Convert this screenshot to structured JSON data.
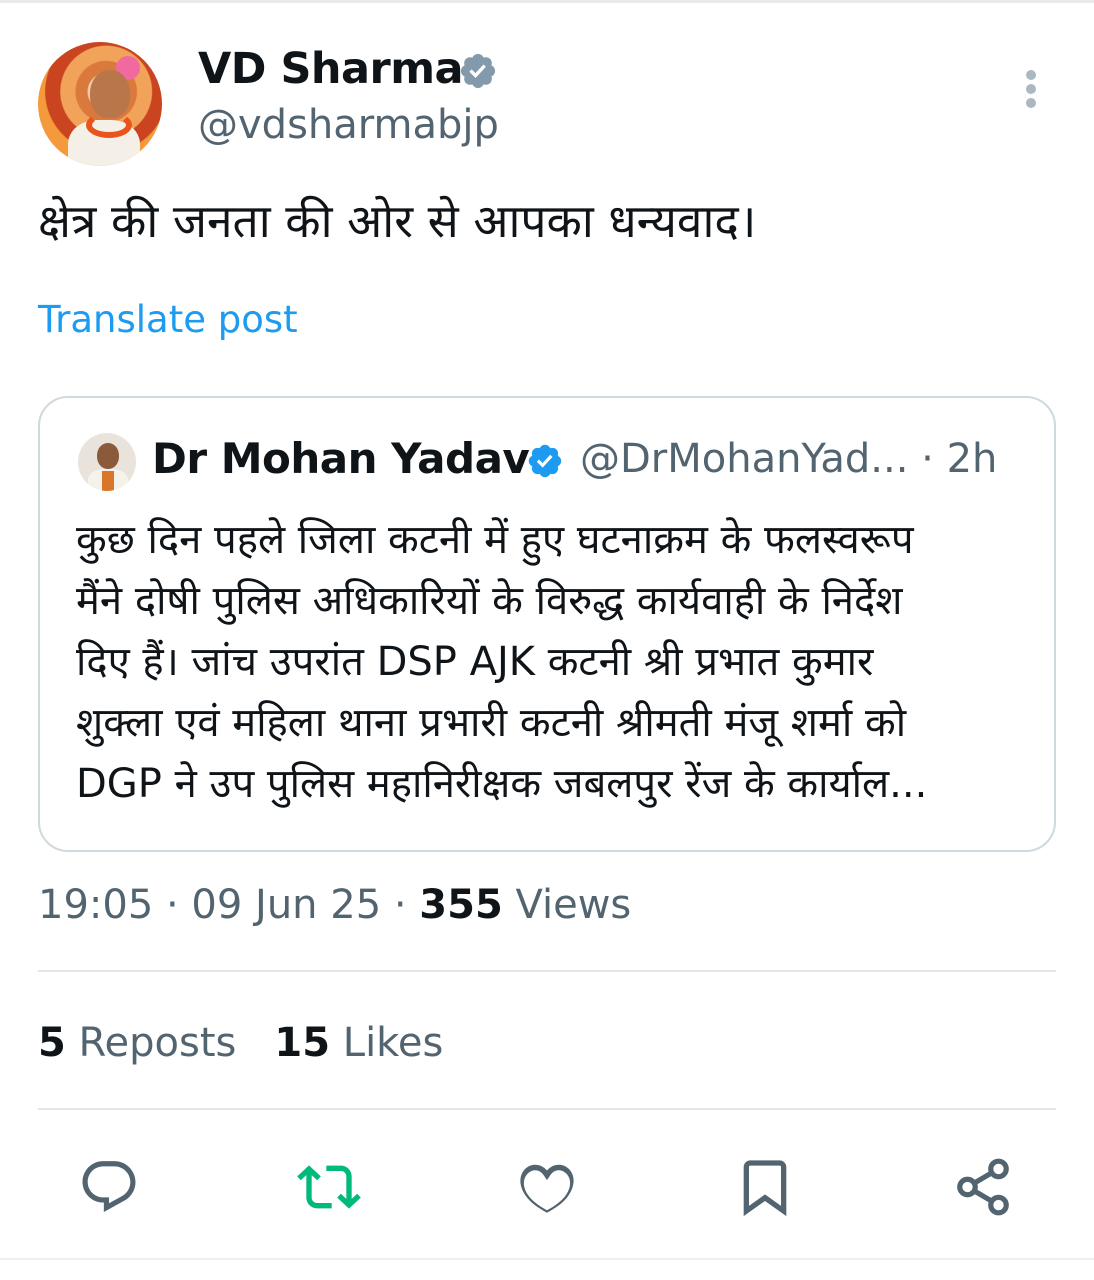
{
  "author": {
    "name": "VD Sharma",
    "handle": "@vdsharmabjp",
    "verified": true
  },
  "tweet": {
    "text": "क्षेत्र की जनता की ओर से आपका धन्यवाद।",
    "translate_label": "Translate post"
  },
  "quote": {
    "name": "Dr Mohan Yadav",
    "handle": "@DrMohanYad... · 2h",
    "verified": true,
    "text_lines": [
      "कुछ दिन पहले जिला कटनी में हुए घटनाक्रम के फलस्वरूप",
      "मैंने दोषी पुलिस अधिकारियों के विरुद्ध कार्यवाही के निर्देश",
      "दिए हैं। जांच उपरांत DSP AJK कटनी श्री प्रभात कुमार",
      "शुक्ला एवं महिला थाना प्रभारी कटनी श्रीमती मंजू शर्मा को",
      "DGP ने उप पुलिस महानिरीक्षक जबलपुर रेंज के कार्याल..."
    ]
  },
  "meta": {
    "time_date": "19:05 · 09 Jun 25 · ",
    "views_count": "355",
    "views_label": " Views"
  },
  "stats": {
    "reposts_count": "5",
    "reposts_label": " Reposts",
    "likes_count": "15",
    "likes_label": " Likes"
  },
  "actions": {
    "reply_icon": "reply-icon",
    "repost_icon": "repost-icon",
    "like_icon": "like-icon",
    "bookmark_icon": "bookmark-icon",
    "share_icon": "share-icon"
  },
  "colors": {
    "accent": "#1d9bf0",
    "repost_active": "#00ba7c",
    "icon_gray": "#536471",
    "text": "#0f1419"
  }
}
